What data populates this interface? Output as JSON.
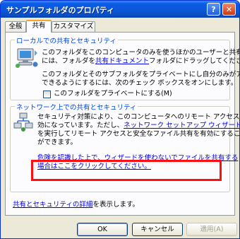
{
  "window": {
    "title": "サンプルフォルダのプロパティ",
    "help_glyph": "?",
    "close_glyph": "✕"
  },
  "tabs": [
    {
      "label": "全般",
      "active": false
    },
    {
      "label": "共有",
      "active": true
    },
    {
      "label": "カスタマイズ",
      "active": false
    }
  ],
  "local_group": {
    "legend": "ローカルでの共有とセキュリティ",
    "para1": {
      "line1": "このフォルダをこのコンピュータのみを使うほかのユーザーと共有する",
      "line2_pre": "には、フォルダを",
      "line2_link": "共有ドキュメント",
      "line2_post": "フォルダにドラッグしてください。"
    },
    "para2": {
      "line1": "このフォルダとそのサブフォルダをプライベートにし自分のみがアクセス",
      "line2": "できるようにするには、次のチェック ボックスをオンにします。"
    },
    "checkbox_label": "このフォルダをプライベートにする(M)",
    "checkbox_checked": false
  },
  "network_group": {
    "legend": "ネットワーク上での共有とセキュリティ",
    "para": {
      "line1": "セキュリティ対策により、このコンピュータへのリモート アクセスは無",
      "line2_pre": "効になっています。ただし、",
      "line2_link": "ネットワーク セットアップ ウィザード",
      "line3": "を実行してリモート アクセスと安全なファイル共有を有効にすること",
      "line4": "ができます。"
    },
    "risk_link": {
      "line1": "危険を認識した上で、ウィザードを使わないでファイルを共有する",
      "line2": "場合はここをクリックしてください。"
    }
  },
  "details_link": {
    "link": "共有とセキュリティの詳細",
    "post": "を表示します。"
  },
  "buttons": {
    "ok": "OK",
    "cancel": "キャンセル",
    "apply": "適用(A)"
  }
}
